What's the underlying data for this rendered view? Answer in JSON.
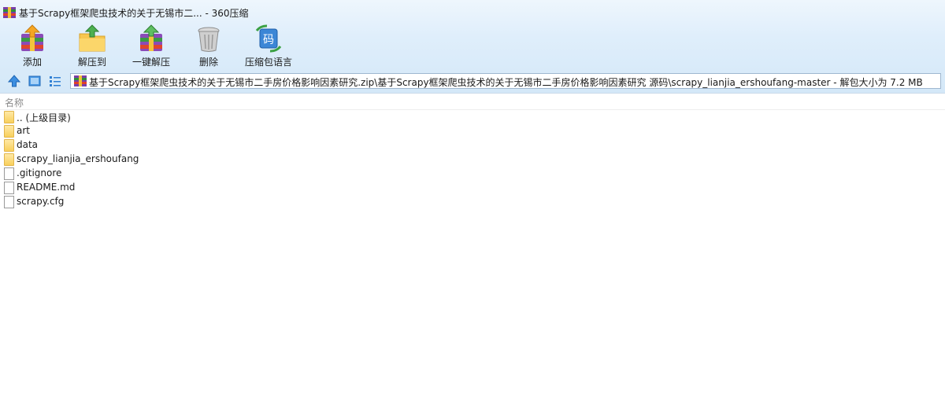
{
  "window": {
    "title": "基于Scrapy框架爬虫技术的关于无锡市二... - 360压缩"
  },
  "toolbar": {
    "items": [
      {
        "label": "添加",
        "icon": "add-archive-icon"
      },
      {
        "label": "解压到",
        "icon": "extract-to-icon"
      },
      {
        "label": "一键解压",
        "icon": "one-click-extract-icon"
      },
      {
        "label": "删除",
        "icon": "delete-icon"
      },
      {
        "label": "压缩包语言",
        "icon": "archive-language-icon",
        "glyph": "码"
      }
    ]
  },
  "navbar": {
    "address": "基于Scrapy框架爬虫技术的关于无锡市二手房价格影响因素研究.zip\\基于Scrapy框架爬虫技术的关于无锡市二手房价格影响因素研究 源码\\scrapy_lianjia_ershoufang-master - 解包大小为 7.2 MB"
  },
  "list": {
    "column_name": "名称",
    "rows": [
      {
        "name": ".. (上级目录)",
        "type": "folder"
      },
      {
        "name": "art",
        "type": "folder"
      },
      {
        "name": "data",
        "type": "folder"
      },
      {
        "name": "scrapy_lianjia_ershoufang",
        "type": "folder"
      },
      {
        "name": ".gitignore",
        "type": "file"
      },
      {
        "name": "README.md",
        "type": "file"
      },
      {
        "name": "scrapy.cfg",
        "type": "file"
      }
    ]
  },
  "colors": {
    "toolbar_bg_top": "#eef6fd",
    "toolbar_bg_bottom": "#d4e8f8",
    "accent_blue": "#2f7fd4",
    "folder": "#f8cf5c"
  }
}
